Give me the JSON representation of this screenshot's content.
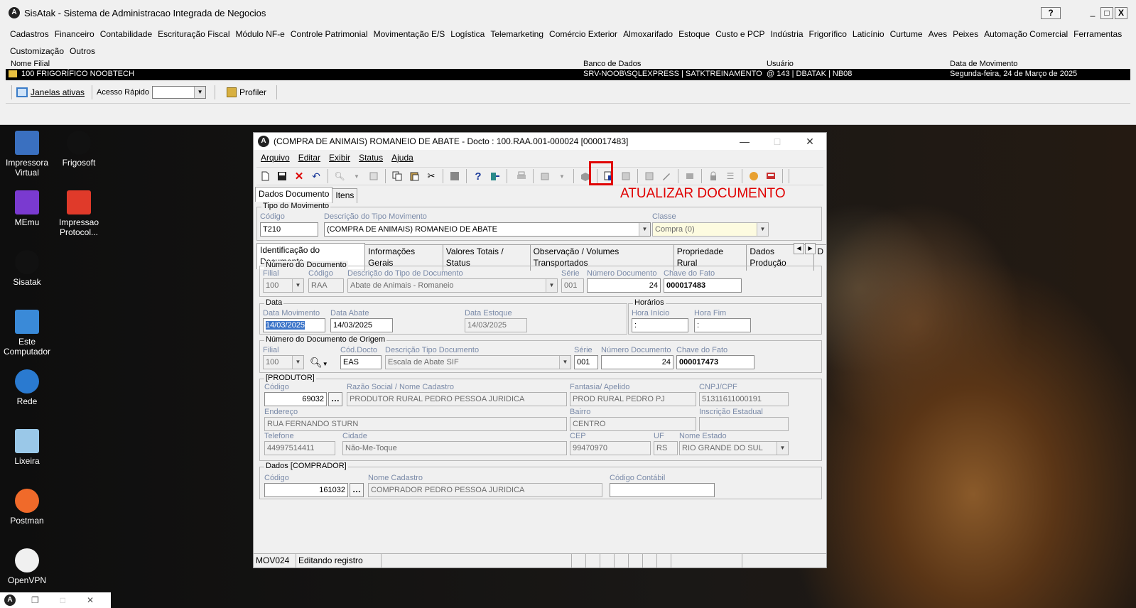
{
  "app": {
    "title": "SisAtak - Sistema de Administracao Integrada de Negocios",
    "help_label": "?",
    "min_label": "_",
    "max_label": "□",
    "close_label": "X"
  },
  "menu": [
    "Cadastros",
    "Financeiro",
    "Contabilidade",
    "Escrituração Fiscal",
    "Módulo NF-e",
    "Controle Patrimonial",
    "Movimentação E/S",
    "Logística",
    "Telemarketing",
    "Comércio Exterior",
    "Almoxarifado",
    "Estoque",
    "Custo e PCP",
    "Indústria",
    "Frigorífico",
    "Laticínio",
    "Curtume",
    "Aves",
    "Peixes",
    "Automação Comercial",
    "Ferramentas",
    "Customização",
    "Outros"
  ],
  "filial_header": {
    "nome_filial": "Nome Filial",
    "banco": "Banco de Dados",
    "usuario": "Usuário",
    "data_movimento": "Data de Movimento"
  },
  "filial_row": {
    "nome": "100 FRIGORÍFICO NOOBTECH",
    "banco": "SRV-NOOB\\SQLEXPRESS | SATKTREINAMENTO",
    "usuario": "@ 143 | DBATAK | NB08",
    "data": "Segunda-feira, 24 de Março de 2025"
  },
  "toolbar": {
    "janelas": "Janelas ativas",
    "acesso_rapido": "Acesso Rápido",
    "profiler": "Profiler"
  },
  "desktop_icons": [
    {
      "label": "Impressora Virtual",
      "icon": "printer-icon"
    },
    {
      "label": "Frigosoft",
      "icon": "frigosoft-icon"
    },
    {
      "label": "MEmu",
      "icon": "memu-icon"
    },
    {
      "label": "Impressao Protocol...",
      "icon": "pdf-icon"
    },
    {
      "label": "Sisatak",
      "icon": "sisatak-icon"
    },
    {
      "label": "Este Computador",
      "icon": "computer-icon"
    },
    {
      "label": "Rede",
      "icon": "network-icon"
    },
    {
      "label": "Lixeira",
      "icon": "recycle-bin-icon"
    },
    {
      "label": "Postman",
      "icon": "postman-icon"
    },
    {
      "label": "OpenVPN",
      "icon": "openvpn-icon"
    }
  ],
  "doc": {
    "title": "(COMPRA DE ANIMAIS) ROMANEIO DE ABATE - Docto : 100.RAA.001-000024 [000017483]",
    "menu": [
      "Arquivo",
      "Editar",
      "Exibir",
      "Status",
      "Ajuda"
    ],
    "annotation": "ATUALIZAR DOCUMENTO",
    "tabs_top": [
      "Dados Documento",
      "Itens"
    ],
    "tipo_movimento": {
      "group": "Tipo do Movimento",
      "codigo_lbl": "Código",
      "codigo": "T210",
      "descricao_lbl": "Descrição do Tipo Movimento",
      "descricao": "(COMPRA DE ANIMAIS) ROMANEIO DE ABATE",
      "classe_lbl": "Classe",
      "classe": "Compra (0)"
    },
    "tabs_inner": [
      "Identificação do Documento",
      "Informações Gerais",
      "Valores Totais / Status",
      "Observação / Volumes Transportados",
      "Propriedade Rural",
      "Dados Produção",
      "D"
    ],
    "numero_documento": {
      "group": "Número do Documento",
      "filial_lbl": "Filial",
      "filial": "100",
      "codigo_lbl": "Código",
      "codigo": "RAA",
      "descricao_lbl": "Descrição do Tipo de Documento",
      "descricao": "Abate de Animais - Romaneio",
      "serie_lbl": "Série",
      "serie": "001",
      "numero_lbl": "Número Documento",
      "numero": "24",
      "chave_lbl": "Chave do Fato",
      "chave": "000017483"
    },
    "data": {
      "group": "Data",
      "mov_lbl": "Data Movimento",
      "mov": "14/03/2025",
      "abate_lbl": "Data Abate",
      "abate": "14/03/2025",
      "estoque_lbl": "Data Estoque",
      "estoque": "14/03/2025"
    },
    "horarios": {
      "group": "Horários",
      "inicio_lbl": "Hora Início",
      "inicio": ":",
      "fim_lbl": "Hora Fim",
      "fim": ":"
    },
    "origem": {
      "group": "Número do Documento de Origem",
      "filial_lbl": "Filial",
      "filial": "100",
      "cod_lbl": "Cód.Docto",
      "cod": "EAS",
      "descricao_lbl": "Descrição Tipo Documento",
      "descricao": "Escala de Abate SIF",
      "serie_lbl": "Série",
      "serie": "001",
      "numero_lbl": "Número Documento",
      "numero": "24",
      "chave_lbl": "Chave do Fato",
      "chave": "000017473"
    },
    "produtor": {
      "group": "[PRODUTOR]",
      "codigo_lbl": "Código",
      "codigo": "69032",
      "razao_lbl": "Razão Social / Nome Cadastro",
      "razao": "PRODUTOR RURAL PEDRO PESSOA JURIDICA",
      "fantasia_lbl": "Fantasia/ Apelido",
      "fantasia": "PROD RURAL PEDRO PJ",
      "cnpj_lbl": "CNPJ/CPF",
      "cnpj": "51311611000191",
      "endereco_lbl": "Endereço",
      "endereco": "RUA FERNANDO STURN",
      "bairro_lbl": "Bairro",
      "bairro": "CENTRO",
      "ie_lbl": "Inscrição Estadual",
      "ie": "",
      "telefone_lbl": "Telefone",
      "telefone": "44997514411",
      "cidade_lbl": "Cidade",
      "cidade": "Não-Me-Toque",
      "cep_lbl": "CEP",
      "cep": "99470970",
      "uf_lbl": "UF",
      "uf": "RS",
      "estado_lbl": "Nome Estado",
      "estado": "RIO GRANDE DO SUL"
    },
    "comprador": {
      "group": "Dados [COMPRADOR]",
      "codigo_lbl": "Código",
      "codigo": "161032",
      "nome_lbl": "Nome Cadastro",
      "nome": "COMPRADOR PEDRO PESSOA JURIDICA",
      "contabil_lbl": "Código Contábil",
      "contabil": ""
    },
    "status": {
      "code": "MOV024",
      "text": "Editando registro"
    }
  }
}
